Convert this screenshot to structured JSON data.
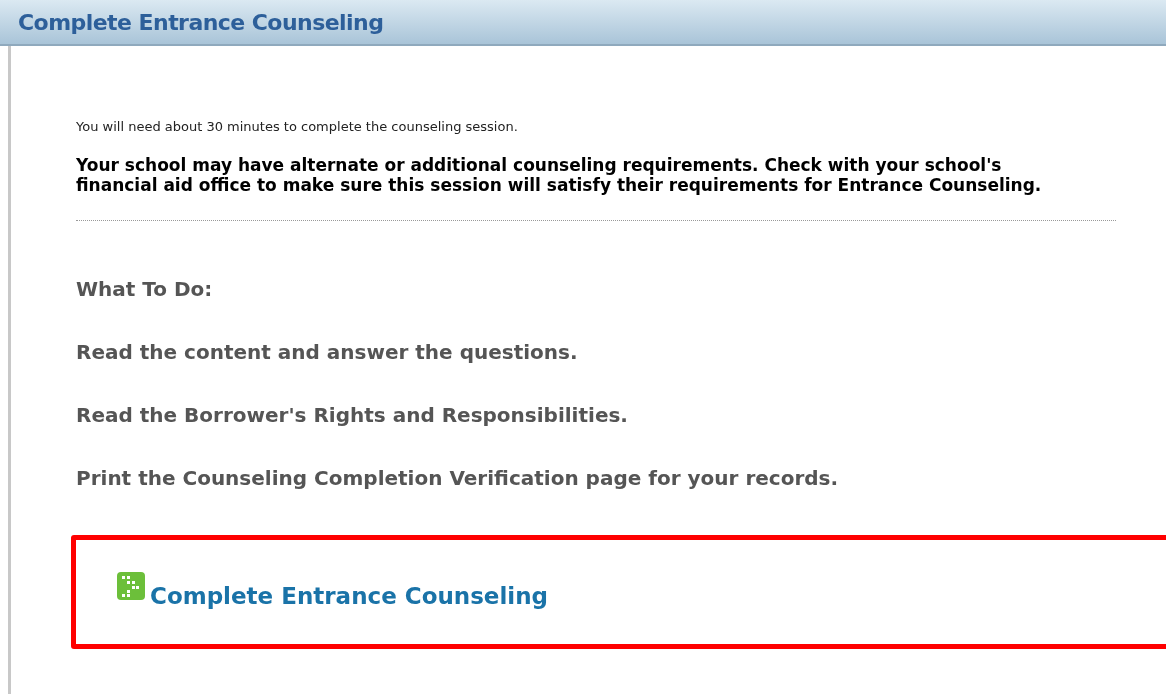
{
  "header": {
    "title": "Complete Entrance Counseling"
  },
  "intro": "You will need about 30 minutes to complete the counseling session.",
  "notice": "Your school may have alternate or additional counseling requirements. Check with your school's financial aid office to make sure this session will satisfy their requirements for Entrance Counseling.",
  "steps_heading": "What To Do:",
  "steps": [
    "Read the content and answer the questions.",
    "Read the Borrower's Rights and Responsibilities.",
    "Print the Counseling Completion Verification page for your records."
  ],
  "action_link": {
    "label": "Complete Entrance Counseling"
  }
}
